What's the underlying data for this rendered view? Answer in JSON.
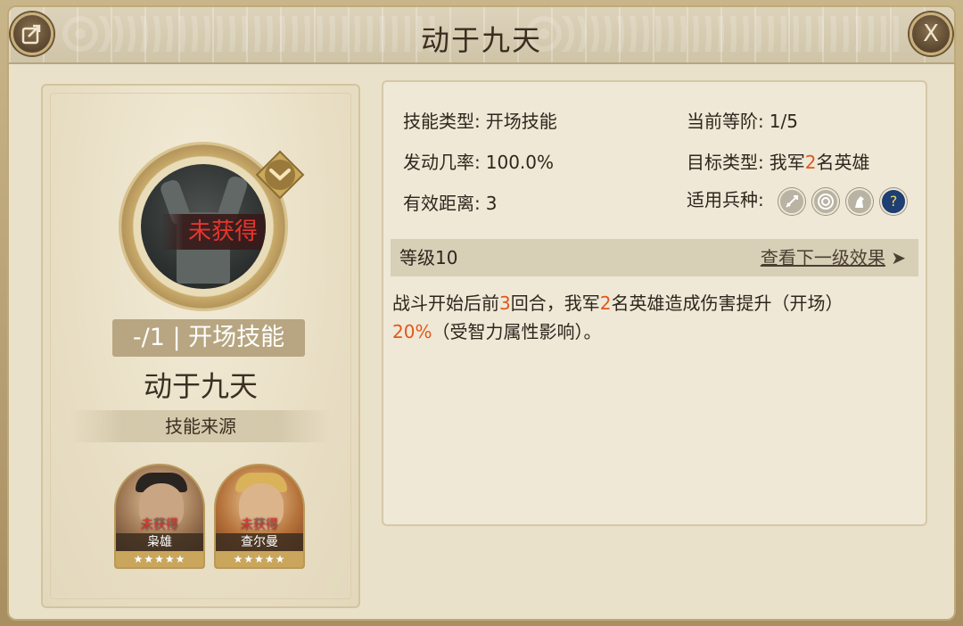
{
  "header": {
    "title": "动于九天",
    "share_icon": "share-icon",
    "close_label": "X"
  },
  "skill_card": {
    "status_text": "未获得",
    "level_pill": "-/1 | 开场技能",
    "name": "动于九天",
    "source_title": "技能来源"
  },
  "heroes": [
    {
      "status": "未获得",
      "name": "枭雄",
      "stars": "★★★★★"
    },
    {
      "status": "未获得",
      "name": "查尔曼",
      "stars": "★★★★★"
    }
  ],
  "info": {
    "skill_type_label": "技能类型:",
    "skill_type_value": "开场技能",
    "current_rank_label": "当前等阶:",
    "current_rank_value": "1/5",
    "trigger_rate_label": "发动几率:",
    "trigger_rate_value": "100.0%",
    "target_type_label": "目标类型:",
    "target_prefix": "我军",
    "target_count": "2",
    "target_suffix": "名英雄",
    "range_label": "有效距离:",
    "range_value": "3",
    "troop_label": "适用兵种:",
    "troop_icons": [
      "sword-icon",
      "target-icon",
      "horse-icon",
      "question-icon"
    ]
  },
  "level": {
    "label": "等级10",
    "next_link": "查看下一级效果",
    "next_arrow": "➤"
  },
  "effect": {
    "part1": "战斗开始后前",
    "rounds": "3",
    "part2": "回合，我军",
    "heroes": "2",
    "part3": "名英雄造成伤害提升（开场）",
    "percent": "20%",
    "part4": "（受智力属性影响）。"
  },
  "colors": {
    "highlight": "#e0581c",
    "status_red": "#e8352c",
    "panel_bg": "#eae1ca"
  }
}
